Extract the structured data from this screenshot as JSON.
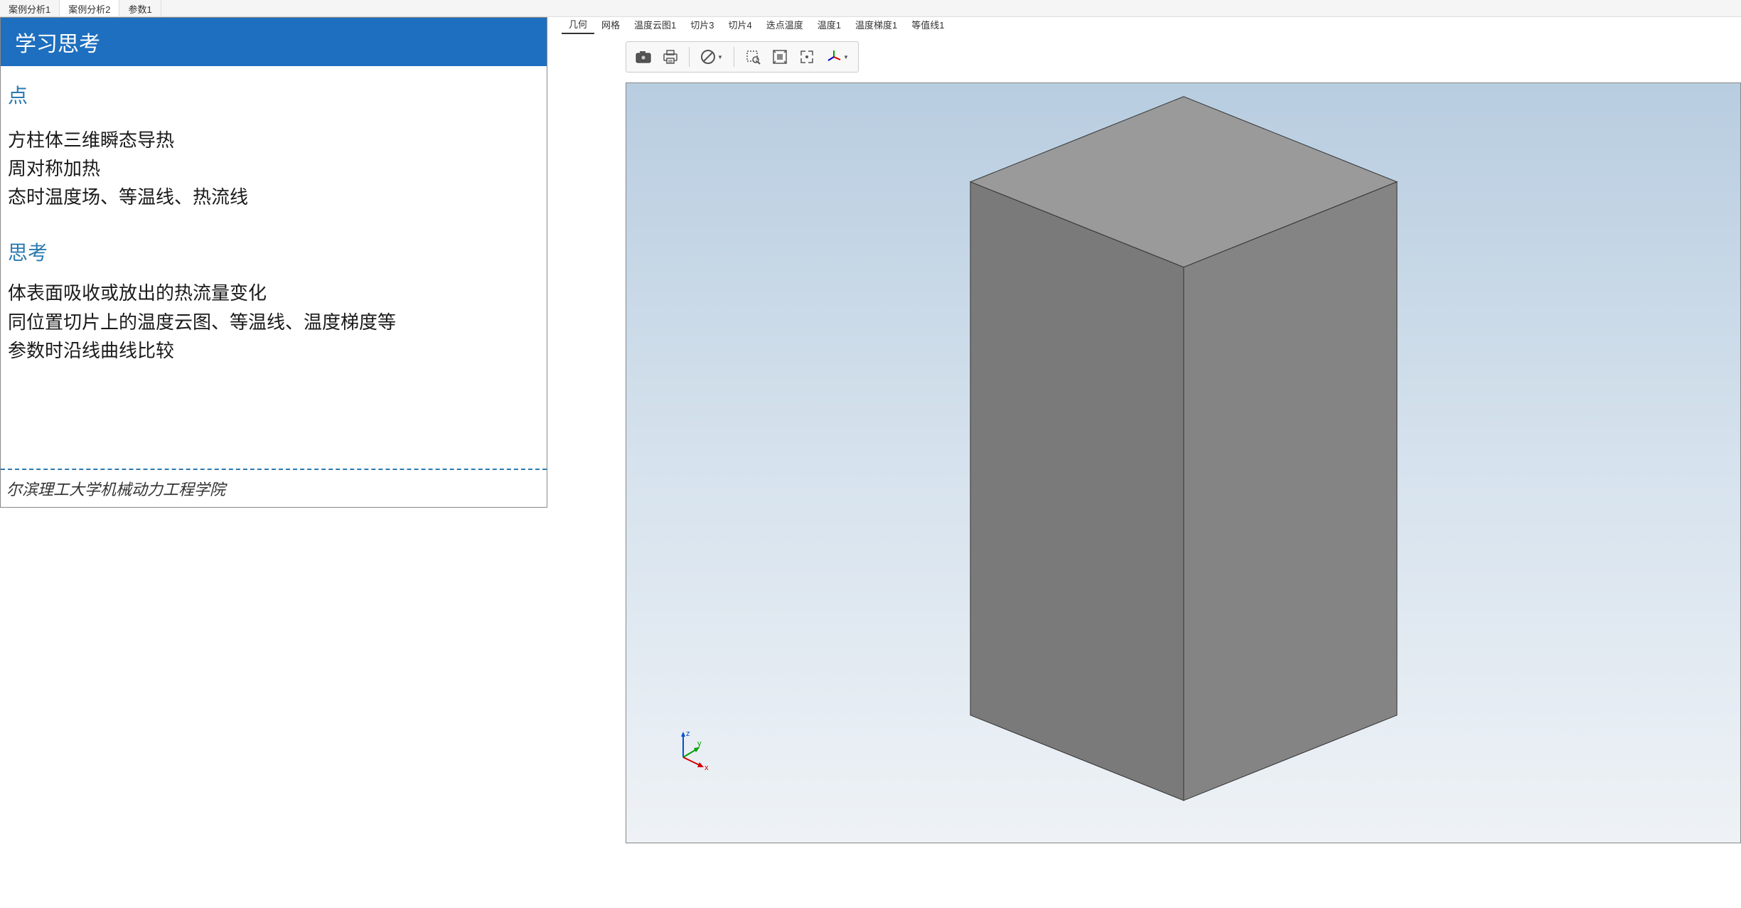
{
  "top_tabs": [
    {
      "label": "案例分析1",
      "active": false
    },
    {
      "label": "案例分析2",
      "active": true
    },
    {
      "label": "参数1",
      "active": false
    }
  ],
  "panel": {
    "header": "学习思考",
    "section1_title": "点",
    "section1_lines": [
      "方柱体三维瞬态导热",
      "周对称加热",
      "态时温度场、等温线、热流线"
    ],
    "section2_title": "思考",
    "section2_lines": [
      "体表面吸收或放出的热流量变化",
      "同位置切片上的温度云图、等温线、温度梯度等",
      "参数时沿线曲线比较"
    ],
    "footer": "尔滨理工大学机械动力工程学院"
  },
  "view_tabs": [
    {
      "label": "几何",
      "active": true
    },
    {
      "label": "网格",
      "active": false
    },
    {
      "label": "温度云图1",
      "active": false
    },
    {
      "label": "切片3",
      "active": false
    },
    {
      "label": "切片4",
      "active": false
    },
    {
      "label": "迭点温度",
      "active": false
    },
    {
      "label": "温度1",
      "active": false
    },
    {
      "label": "温度梯度1",
      "active": false
    },
    {
      "label": "等值线1",
      "active": false
    }
  ],
  "toolbar": {
    "camera": "camera-icon",
    "print": "print-icon",
    "denied": "denied-icon",
    "zoom_box": "zoom-box-icon",
    "zoom_extents": "zoom-extents-icon",
    "zoom_full": "zoom-full-icon",
    "axis": "axis-icon"
  },
  "axis": {
    "x_label": "x",
    "y_label": "y",
    "z_label": "z"
  },
  "colors": {
    "header_bg": "#1e6fbf",
    "accent": "#2a7ab0",
    "viewport_top": "#b8cde0",
    "viewport_bottom": "#eef2f6"
  }
}
